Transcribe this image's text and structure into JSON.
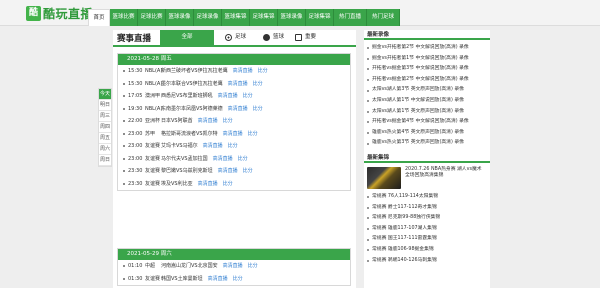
{
  "logo": {
    "badge": "酷",
    "text": "酷玩直播"
  },
  "nav": {
    "home": "首页",
    "items": [
      "篮球比赛",
      "足球比赛",
      "篮球录像",
      "足球录像",
      "篮球集锦",
      "足球集锦",
      "篮球录像",
      "足球集锦",
      "热门直播",
      "热门足球"
    ]
  },
  "main": {
    "title": "赛事直播",
    "tabs": {
      "all": "全部",
      "football": "足球",
      "basketball": "篮球",
      "other": "重要"
    },
    "side_tabs": [
      "今天",
      "明日",
      "周三",
      "周四",
      "周五",
      "周六",
      "周日"
    ],
    "days": [
      {
        "label": "2021-05-28 周五",
        "rows": [
          {
            "time": "15:30",
            "league": "NBL(A)",
            "match": "新西兰破坏者VS伊拉瓦拉老鹰",
            "link": "高清直播",
            "score": "比分"
          },
          {
            "time": "15:30",
            "league": "NBL(A)",
            "match": "墨尔本联合VS伊拉瓦拉老鹰",
            "link": "高清直播",
            "score": "比分"
          },
          {
            "time": "17:05",
            "league": "澳洲甲",
            "match": "西悉尼VS布里斯班狮吼",
            "link": "高清直播",
            "score": "比分"
          },
          {
            "time": "19:30",
            "league": "NBL(A)",
            "match": "东南墨尔本凤凰VS阿德莱德",
            "link": "高清直播",
            "score": "比分"
          },
          {
            "time": "22:00",
            "league": "亚洲杯",
            "match": "日本VS阿联酋",
            "link": "高清直播",
            "score": "比分"
          },
          {
            "time": "23:00",
            "league": "苏甲",
            "match": "格拉斯哥流浪者VS凯尔特",
            "link": "高清直播",
            "score": "比分"
          },
          {
            "time": "23:00",
            "league": "友谊赛",
            "match": "艾玛卡VS马福尔",
            "link": "高清直播",
            "score": "比分"
          },
          {
            "time": "23:00",
            "league": "友谊赛",
            "match": "马尔代夫VS孟加拉国",
            "link": "高清直播",
            "score": "比分"
          },
          {
            "time": "23:30",
            "league": "友谊赛",
            "match": "黎巴嫩VS乌兹别克斯坦",
            "link": "高清直播",
            "score": "比分"
          },
          {
            "time": "23:30",
            "league": "友谊赛",
            "match": "埃及VS利比亚",
            "link": "高清直播",
            "score": "比分"
          }
        ]
      },
      {
        "label": "2021-05-29 周六",
        "rows": [
          {
            "time": "01:10",
            "league": "中超",
            "match": "河南嵩山龙门VS北京国安",
            "link": "高清直播",
            "score": "比分"
          },
          {
            "time": "01:30",
            "league": "友谊赛",
            "match": "韩国VS土库曼斯坦",
            "link": "高清直播",
            "score": "比分"
          }
        ]
      }
    ]
  },
  "right": {
    "recent_title": "最新录像",
    "recent_items": [
      "掘金vs开拓者第2节 中文解说回放(高清) 录像",
      "掘金vs开拓者第1节 中文解说回放(高清) 录像",
      "开拓者vs掘金第3节 中文解说回放(高清) 录像",
      "开拓者vs掘金第2节 中文解说回放(高清) 录像",
      "太阳vs湖人第3节 英文原声回放(高清) 录像",
      "太阳vs湖人第1节 中文解说回放(高清) 录像",
      "太阳vs湖人第1节 英文原声回放(高清) 录像",
      "开拓者vs掘金第4节 中文解说回放(高清) 录像",
      "雄鹿vs热火第4节 英文原声回放(高清) 录像",
      "雄鹿vs热火第3节 英文原声回放(高清) 录像"
    ],
    "highlights_title": "最新集锦",
    "feature_text": "2020.7.26 NBA热身赛 湖人vs魔术 全场回放高清集锦",
    "highlight_items": [
      "常规赛 76人119-114太阳集锦",
      "常规赛 爵士117-112奇才集锦",
      "常规赛 尼克斯99-88独行侠集锦",
      "常规赛 雄鹿117-107湖人集锦",
      "常规赛 国王117-111雷霆集锦",
      "常规赛 雄鹿106-98掘金集锦",
      "常规赛 鹈鹕140-126马刺集锦"
    ]
  }
}
